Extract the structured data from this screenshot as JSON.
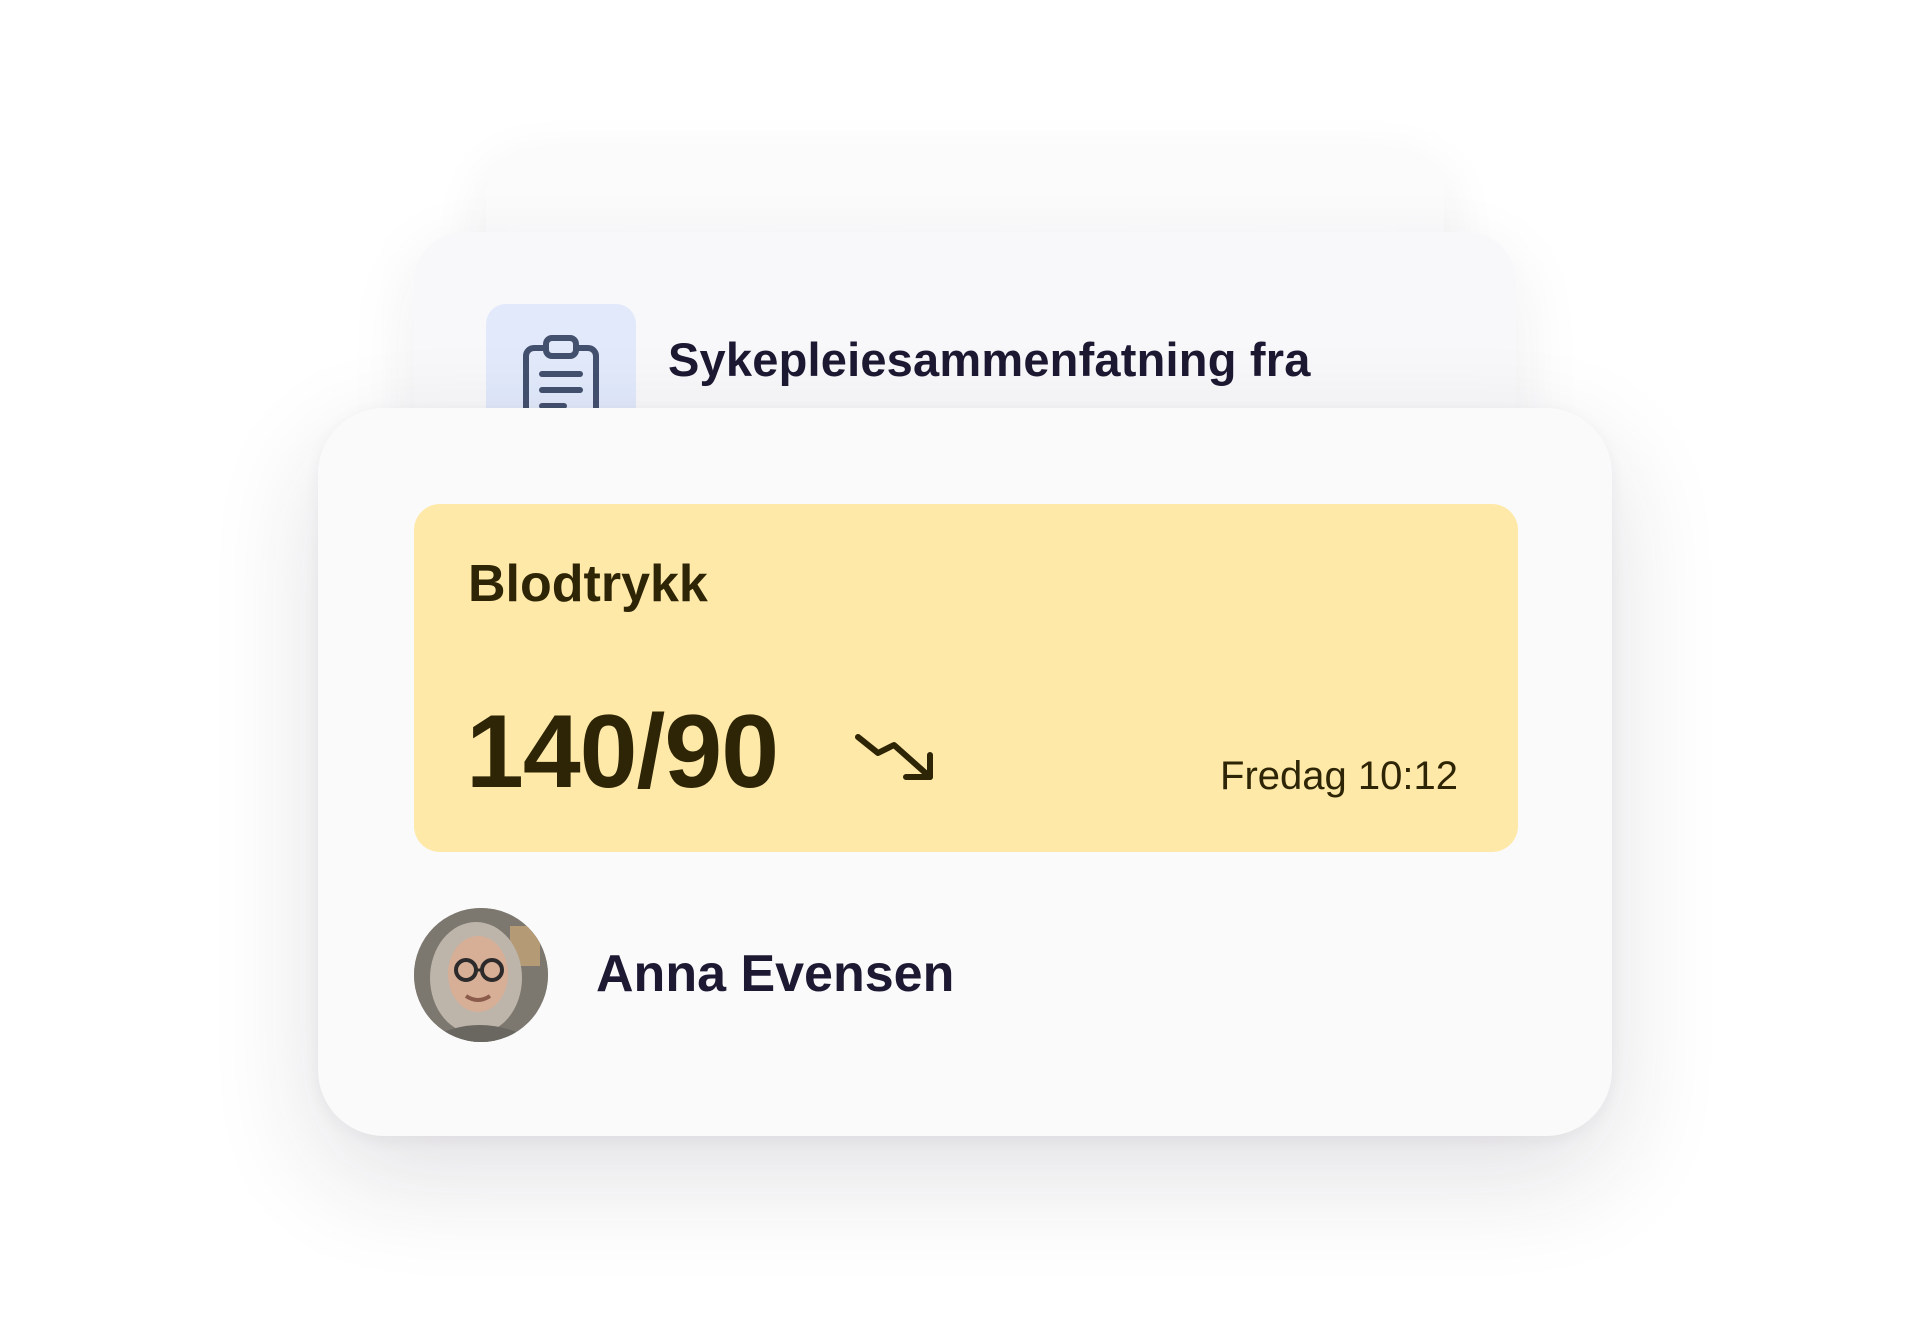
{
  "document_card": {
    "title": "Sykepleiesammenfatning fra",
    "icon": "clipboard-icon"
  },
  "vital_card": {
    "label": "Blodtrykk",
    "value": "140/90",
    "trend_icon": "trend-down-icon",
    "timestamp": "Fredag 10:12",
    "panel_color": "#fee9a8",
    "text_color": "#2e2506"
  },
  "patient": {
    "name": "Anna Evensen",
    "avatar_icon": "avatar"
  },
  "colors": {
    "icon_tile": "#e1e9fb",
    "icon_stroke": "#43506e",
    "heading_text": "#1d1933"
  }
}
